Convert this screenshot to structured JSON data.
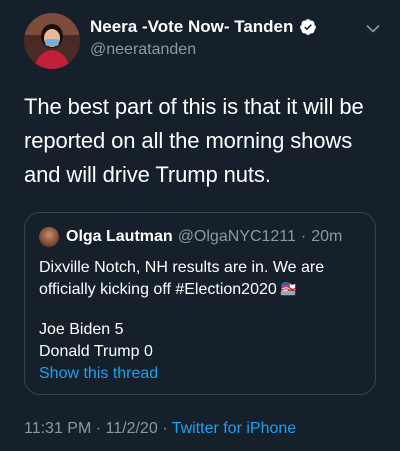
{
  "author": {
    "display_name": "Neera -Vote Now- Tanden",
    "handle": "@neeratanden",
    "avatar": "avatar-photo",
    "verified_icon": "verified-badge-icon"
  },
  "more_icon": "chevron-down-icon",
  "tweet": {
    "text": "The best part of this is that it will be reported on all the morning shows and will drive Trump nuts."
  },
  "quote": {
    "name": "Olga Lautman",
    "handle": "@OlgaNYC1211",
    "separator": "·",
    "time": "20m",
    "text": "Dixville Notch, NH results are in. We are officially kicking off #Election2020",
    "emoji": "ballot-box-flag-icon",
    "results": [
      "Joe Biden 5",
      "Donald Trump 0"
    ],
    "show_thread": "Show this thread"
  },
  "meta": {
    "time": "11:31 PM",
    "separator1": "·",
    "date": "11/2/20",
    "separator2": "·",
    "source": "Twitter for iPhone"
  },
  "colors": {
    "background": "#15202b",
    "text": "#ffffff",
    "secondary_text": "#8899a6",
    "link": "#1da1f2",
    "border": "#38444d"
  }
}
